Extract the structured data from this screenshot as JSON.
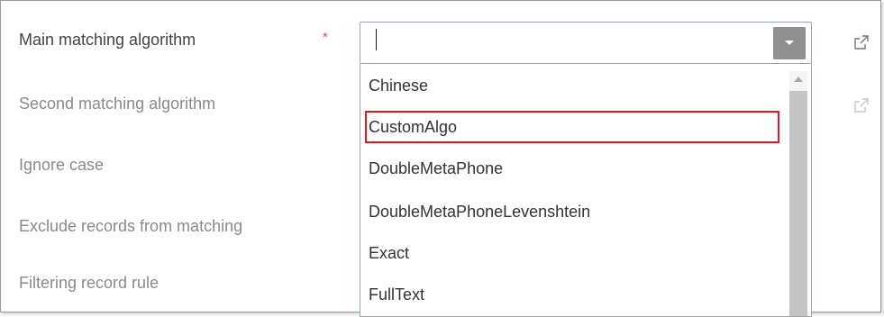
{
  "form": {
    "rows": [
      {
        "label": "Main matching algorithm",
        "required": true
      },
      {
        "label": "Second matching algorithm"
      },
      {
        "label": "Ignore case"
      },
      {
        "label": "Exclude records from matching"
      },
      {
        "label": "Filtering record rule"
      }
    ],
    "required_marker": "*"
  },
  "combo": {
    "value": "",
    "has_caret": true
  },
  "dropdown": {
    "items": [
      "Chinese",
      "CustomAlgo",
      "DoubleMetaPhone",
      "DoubleMetaPhoneLevenshtein",
      "Exact",
      "FullText"
    ],
    "highlighted": "CustomAlgo"
  },
  "icons": {
    "external_link_row1": "external-link-icon",
    "external_link_row2": "external-link-icon"
  },
  "colors": {
    "required": "#e64545",
    "highlight_border": "#e01a1a",
    "combo_border": "#8fa7c9",
    "dropdown_button": "#909090"
  }
}
